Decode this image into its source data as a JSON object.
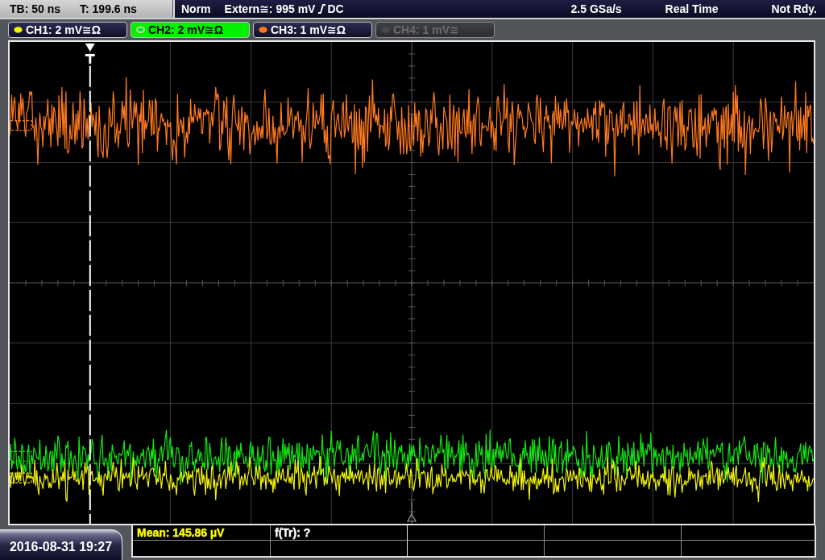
{
  "timebase_panel": {
    "timebase": "TB: 50 ns",
    "trigger_time": "T: 199.6 ns"
  },
  "status_bar": {
    "trigger_mode": "Norm",
    "trigger_source": "Extern≅: 995 mV",
    "trigger_coupling": "DC",
    "sample_rate": "2.5 GSa/s",
    "acquisition": "Real Time",
    "state": "Not Rdy."
  },
  "channels": [
    {
      "label": "CH1: 2 mV≅Ω",
      "color": "#f2f20a",
      "selected": false,
      "disabled": false
    },
    {
      "label": "CH2: 2 mV≅Ω",
      "color": "#12e612",
      "selected": true,
      "disabled": false
    },
    {
      "label": "CH3: 1 mV≅Ω",
      "color": "#ff7a1e",
      "selected": false,
      "disabled": false
    },
    {
      "label": "CH4: 1 mV≅",
      "color": "#4a4a4a",
      "selected": false,
      "disabled": true
    }
  ],
  "measurements": [
    {
      "text": "Mean: 145.86 µV",
      "color": "#ffff00"
    },
    {
      "text": "f(Tr): ?",
      "color": "#ffffff"
    }
  ],
  "timestamp": "2016-08-31 19:27"
}
